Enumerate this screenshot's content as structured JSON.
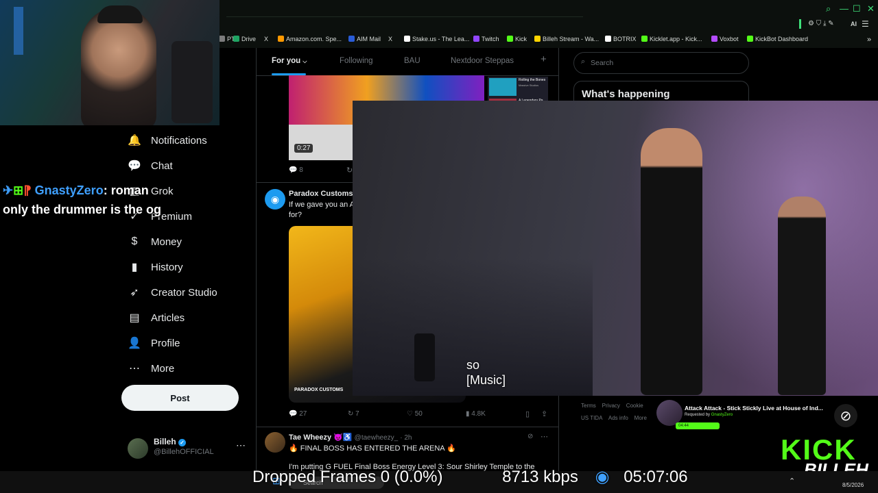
{
  "bookmarks": [
    {
      "label": "PT",
      "color": "#7c7c7c"
    },
    {
      "label": "Drive",
      "color": "#1fa463"
    },
    {
      "label": "X",
      "color": "#ffffff"
    },
    {
      "label": "Amazon.com. Spe...",
      "color": "#ff9900"
    },
    {
      "label": "AIM Mail",
      "color": "#2a5cd6"
    },
    {
      "label": "Stake.us - The Lea...",
      "color": "#ffffff"
    },
    {
      "label": "Twitch",
      "color": "#9146ff"
    },
    {
      "label": "Kick",
      "color": "#53fc18"
    },
    {
      "label": "Billeh Stream - Wa...",
      "color": "#ffd400"
    },
    {
      "label": "BOTRIX",
      "color": "#ffffff"
    },
    {
      "label": "Kicklet.app - Kick...",
      "color": "#53fc18"
    },
    {
      "label": "Voxbot",
      "color": "#b44cff"
    },
    {
      "label": "KickBot Dashboard",
      "color": "#53fc18"
    }
  ],
  "nav": {
    "items": [
      {
        "label": "Notifications",
        "icon": "bell-icon",
        "glyph": "🔔"
      },
      {
        "label": "Chat",
        "icon": "chat-icon",
        "glyph": "💬"
      },
      {
        "label": "Grok",
        "icon": "grok-icon",
        "glyph": "◧"
      },
      {
        "label": "Premium",
        "icon": "verified-icon",
        "glyph": "✓"
      },
      {
        "label": "Money",
        "icon": "money-icon",
        "glyph": "$"
      },
      {
        "label": "History",
        "icon": "bookmark-icon",
        "glyph": "▮"
      },
      {
        "label": "Creator Studio",
        "icon": "rocket-icon",
        "glyph": "➶"
      },
      {
        "label": "Articles",
        "icon": "articles-icon",
        "glyph": "▤"
      },
      {
        "label": "Profile",
        "icon": "person-icon",
        "glyph": "👤"
      },
      {
        "label": "More",
        "icon": "more-icon",
        "glyph": "⋯"
      }
    ],
    "post_label": "Post"
  },
  "profile": {
    "name": "Billeh",
    "handle": "@BillehOFFICIAL"
  },
  "tabs": [
    "For you",
    "Following",
    "BAU",
    "Nextdoor Steppas"
  ],
  "feed": {
    "video_duration": "0:27",
    "reply_count_1": "8",
    "post2": {
      "author": "Paradox Customs",
      "text_line1": "If we gave you an A",
      "text_line2": "for?",
      "brand_overlay": "PARADOX CUSTOMS",
      "stats": {
        "replies": "27",
        "reposts": "7",
        "likes": "50",
        "views": "4.8K"
      }
    },
    "post3": {
      "author": "Tae Wheezy 😈♿",
      "handle": "@taewheezy_",
      "time": "· 2h",
      "text_line1": "🔥 FINAL BOSS HAS ENTERED THE ARENA 🔥",
      "text_line2": "I'm putting G FUEL Final Boss Energy Level 3: Sour Shirley Temple to the"
    }
  },
  "right": {
    "search_placeholder": "Search",
    "happening_title": "What's happening",
    "footer_line1": [
      "Terms",
      "Privacy",
      "Cookie"
    ],
    "footer_line2": [
      "US TIDA",
      "Ads info",
      "More"
    ]
  },
  "carousel": {
    "title": "Rolling the Bones",
    "subtitle1": "Massive Studios",
    "subtitle2": "A Legendary Pa..."
  },
  "chat_overlay": {
    "user": "GnastyZero",
    "line1": "roman",
    "line2": "only the drummer is the og"
  },
  "video": {
    "subtitle_line1": "so",
    "subtitle_line2": "[Music]"
  },
  "now_playing": {
    "title": "Attack Attack - Stick Stickly Live at House of Ind...",
    "requested_prefix": "Requested by",
    "requested_by": "GnastyZero",
    "badge": "04:44"
  },
  "overlay_brand": {
    "kick": "KICK",
    "billeh": "BILLEH"
  },
  "stream_stats": {
    "dropped": "Dropped Frames 0 (0.0%)",
    "bitrate": "8713 kbps",
    "uptime": "05:07:06"
  },
  "taskbar": {
    "search": "Search",
    "date": "8/5/2026"
  },
  "colors": {
    "accent": "#1d9bf0",
    "kick_green": "#53fc18",
    "bg": "#000000"
  }
}
